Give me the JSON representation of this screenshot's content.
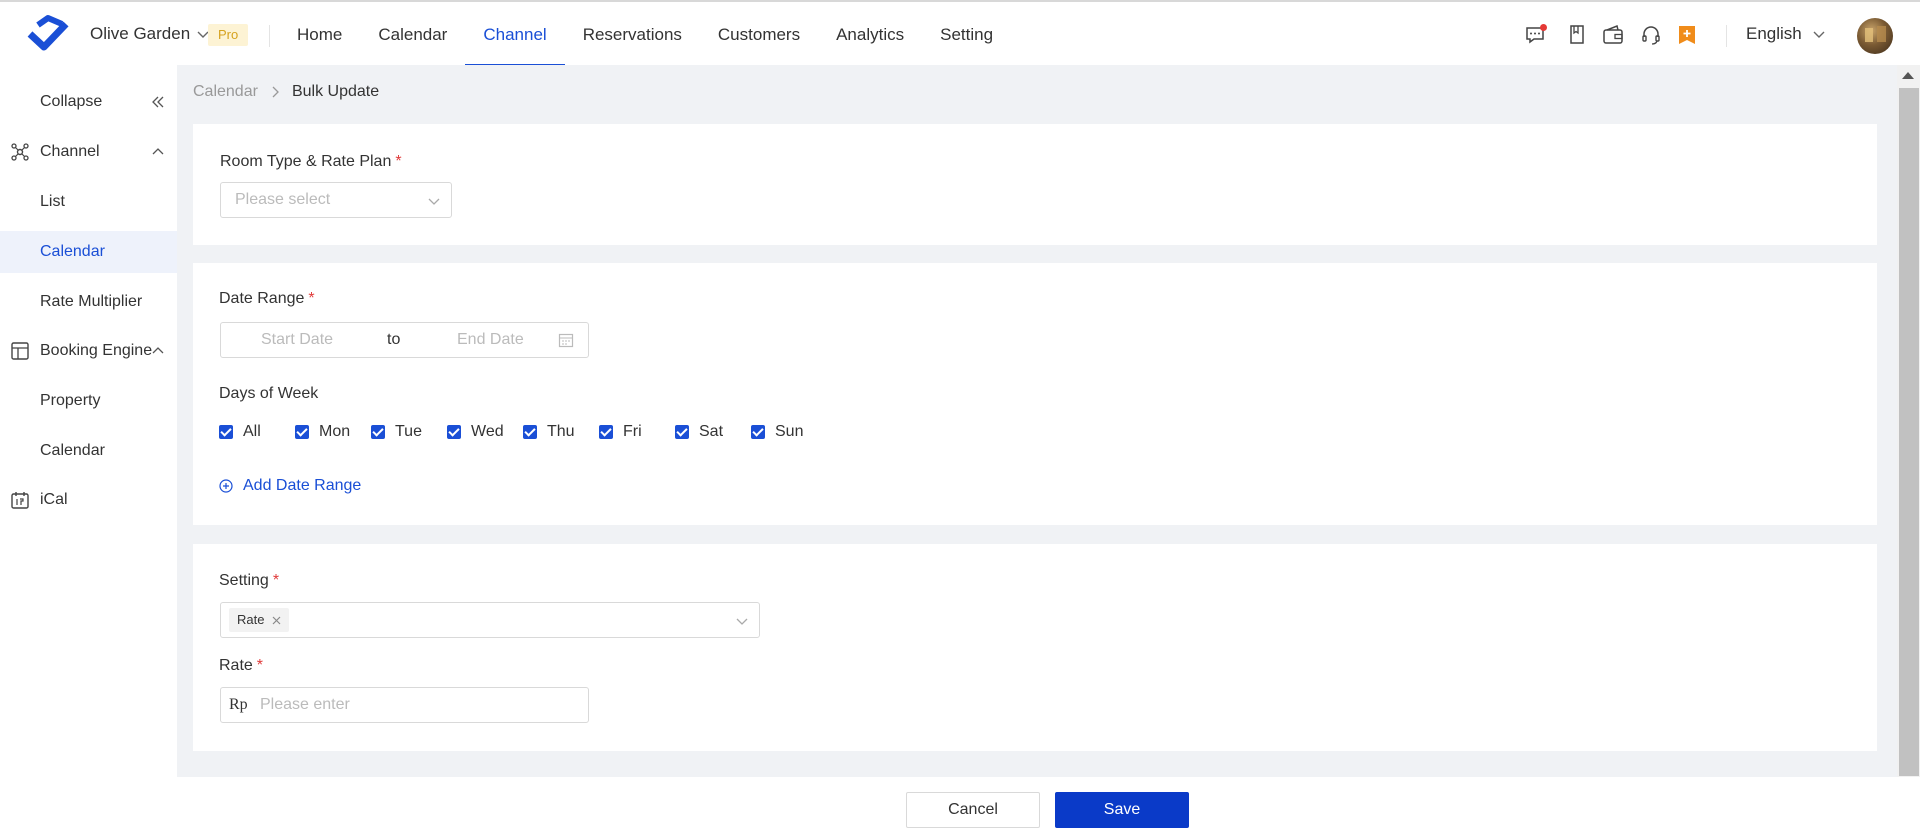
{
  "header": {
    "hotel_name": "Olive Garden",
    "pro_badge": "Pro",
    "nav": [
      {
        "label": "Home",
        "active": false
      },
      {
        "label": "Calendar",
        "active": false
      },
      {
        "label": "Channel",
        "active": true
      },
      {
        "label": "Reservations",
        "active": false
      },
      {
        "label": "Customers",
        "active": false
      },
      {
        "label": "Analytics",
        "active": false
      },
      {
        "label": "Setting",
        "active": false
      }
    ],
    "language": "English",
    "accent_color": "#1a4fd6"
  },
  "sidebar": {
    "collapse_label": "Collapse",
    "items": [
      {
        "label": "Channel",
        "icon": "channel-icon",
        "expanded": true
      },
      {
        "label": "List"
      },
      {
        "label": "Calendar",
        "active": true
      },
      {
        "label": "Rate Multiplier"
      },
      {
        "label": "Booking Engine",
        "icon": "layout-icon",
        "expanded": true
      },
      {
        "label": "Property"
      },
      {
        "label": "Calendar"
      },
      {
        "label": "iCal",
        "icon": "ical-icon"
      }
    ]
  },
  "breadcrumb": {
    "parent": "Calendar",
    "current": "Bulk Update"
  },
  "form": {
    "room_type": {
      "label": "Room Type & Rate Plan",
      "required_mark": "*",
      "placeholder": "Please select"
    },
    "date_range": {
      "label": "Date Range",
      "required_mark": "*",
      "start_placeholder": "Start Date",
      "separator": "to",
      "end_placeholder": "End Date"
    },
    "days_of_week": {
      "label": "Days of Week",
      "options": [
        {
          "label": "All",
          "checked": true
        },
        {
          "label": "Mon",
          "checked": true
        },
        {
          "label": "Tue",
          "checked": true
        },
        {
          "label": "Wed",
          "checked": true
        },
        {
          "label": "Thu",
          "checked": true
        },
        {
          "label": "Fri",
          "checked": true
        },
        {
          "label": "Sat",
          "checked": true
        },
        {
          "label": "Sun",
          "checked": true
        }
      ]
    },
    "add_date_range": "Add Date Range",
    "setting": {
      "label": "Setting",
      "required_mark": "*",
      "selected_tag": "Rate"
    },
    "rate": {
      "label": "Rate",
      "required_mark": "*",
      "currency_prefix": "Rp",
      "placeholder": "Please enter"
    }
  },
  "footer": {
    "cancel_label": "Cancel",
    "save_label": "Save"
  }
}
